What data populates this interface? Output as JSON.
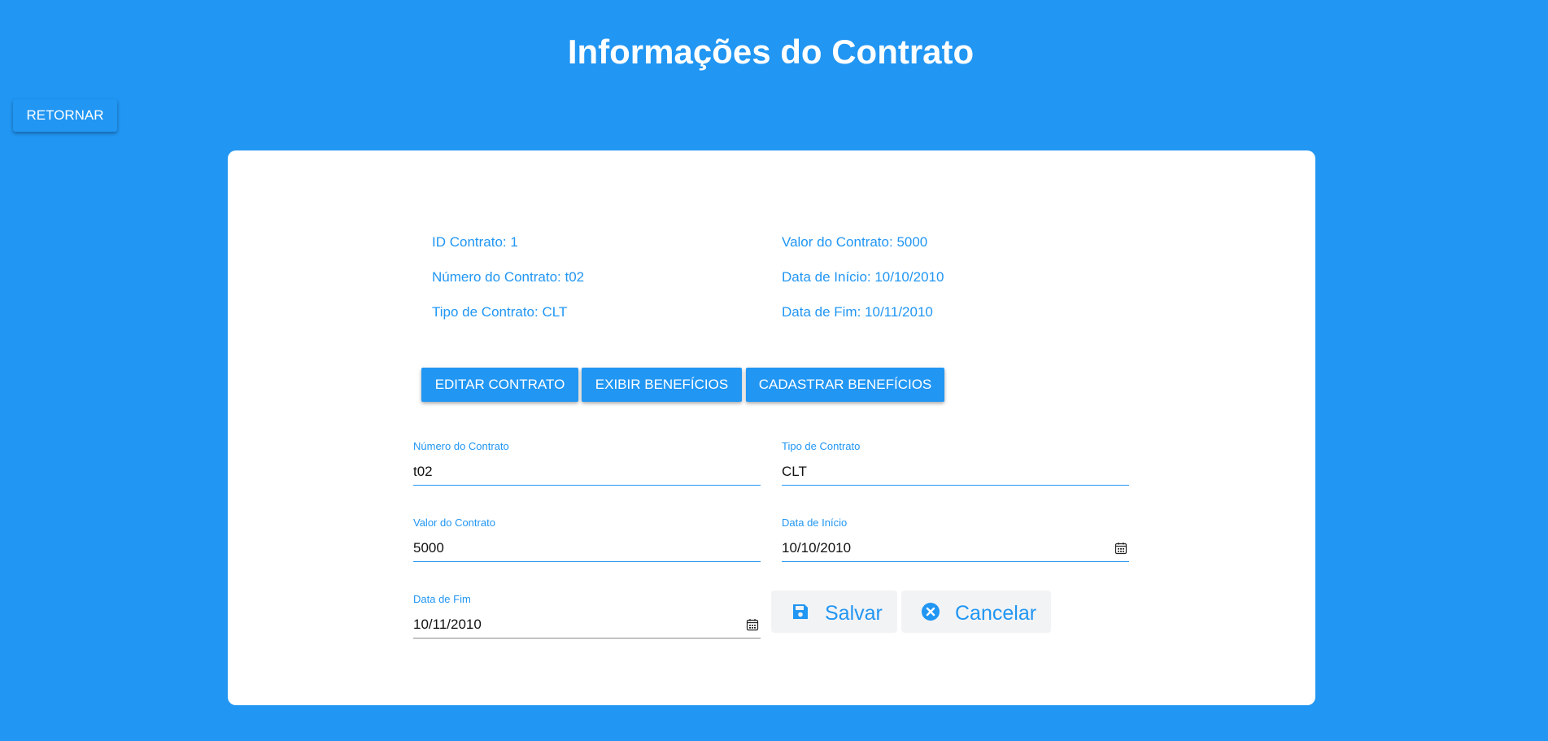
{
  "header": {
    "title": "Informações do Contrato",
    "return_label": "RETORNAR"
  },
  "info": {
    "id": {
      "label": "ID Contrato: ",
      "value": "1"
    },
    "numero": {
      "label": "Número do Contrato: ",
      "value": "t02"
    },
    "tipo": {
      "label": "Tipo de Contrato: ",
      "value": "CLT"
    },
    "valor": {
      "label": "Valor do Contrato: ",
      "value": "5000"
    },
    "inicio": {
      "label": "Data de Início: ",
      "value": "10/10/2010"
    },
    "fim": {
      "label": "Data de Fim: ",
      "value": "10/11/2010"
    }
  },
  "actions": {
    "edit": "EDITAR CONTRATO",
    "show_benefits": "EXIBIR BENEFÍCIOS",
    "register_benefits": "CADASTRAR BENEFÍCIOS"
  },
  "form": {
    "numero": {
      "label": "Número do Contrato",
      "value": "t02"
    },
    "tipo": {
      "label": "Tipo de Contrato",
      "value": "CLT"
    },
    "valor": {
      "label": "Valor do Contrato",
      "value": "5000"
    },
    "inicio": {
      "label": "Data de Início",
      "value": "10/10/2010"
    },
    "fim": {
      "label": "Data de Fim",
      "value": "10/11/2010"
    },
    "save_label": "Salvar",
    "cancel_label": "Cancelar"
  },
  "icons": {
    "save": "save-icon",
    "cancel": "cancel-circle-icon",
    "calendar": "calendar-icon"
  },
  "colors": {
    "primary": "#2196f3",
    "card": "#ffffff",
    "button_bg": "#f2f3f5"
  }
}
